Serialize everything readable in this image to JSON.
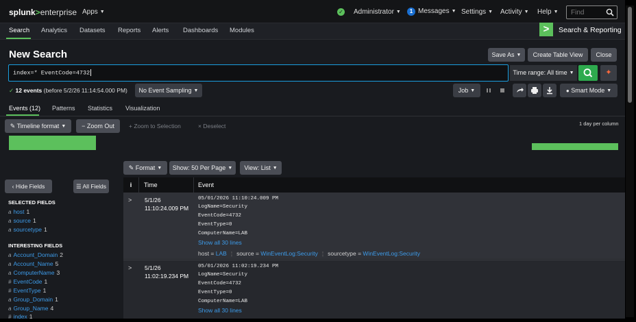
{
  "topbar": {
    "logo_brand": "splunk",
    "logo_chevron": ">",
    "logo_product": "enterprise",
    "apps": "Apps",
    "user": "Administrator",
    "messages_count": "1",
    "messages": "Messages",
    "settings": "Settings",
    "activity": "Activity",
    "help": "Help",
    "find_placeholder": "Find"
  },
  "appnav": {
    "items": [
      "Search",
      "Analytics",
      "Datasets",
      "Reports",
      "Alerts",
      "Dashboards",
      "Modules"
    ],
    "app_logo": ">",
    "app_name": "Search & Reporting"
  },
  "header": {
    "title": "New Search",
    "save_as": "Save As",
    "create_table_view": "Create Table View",
    "close": "Close"
  },
  "search": {
    "query": "index=* EventCode=4732",
    "time_range": "Time range: All time"
  },
  "status": {
    "check": "✓",
    "count": "12 events",
    "before": "(before 5/2/26 11:14:54.000 PM)",
    "sampling": "No Event Sampling",
    "job": "Job",
    "smart_mode": "Smart Mode"
  },
  "tabs": [
    "Events (12)",
    "Patterns",
    "Statistics",
    "Visualization"
  ],
  "timeline": {
    "format": "Timeline format",
    "zoom_out": "Zoom Out",
    "zoom_selection": "Zoom to Selection",
    "deselect": "Deselect",
    "per_column": "1 day per column"
  },
  "results_toolbar": {
    "format": "Format",
    "show": "Show: 50 Per Page",
    "view": "View: List"
  },
  "sidebar": {
    "hide_fields": "Hide Fields",
    "all_fields": "All Fields",
    "selected_heading": "SELECTED FIELDS",
    "selected": [
      {
        "type": "a",
        "name": "host",
        "count": "1"
      },
      {
        "type": "a",
        "name": "source",
        "count": "1"
      },
      {
        "type": "a",
        "name": "sourcetype",
        "count": "1"
      }
    ],
    "interesting_heading": "INTERESTING FIELDS",
    "interesting": [
      {
        "type": "a",
        "name": "Account_Domain",
        "count": "2"
      },
      {
        "type": "a",
        "name": "Account_Name",
        "count": "5"
      },
      {
        "type": "a",
        "name": "ComputerName",
        "count": "3"
      },
      {
        "type": "#",
        "name": "EventCode",
        "count": "1"
      },
      {
        "type": "#",
        "name": "EventType",
        "count": "1"
      },
      {
        "type": "a",
        "name": "Group_Domain",
        "count": "1"
      },
      {
        "type": "a",
        "name": "Group_Name",
        "count": "4"
      },
      {
        "type": "#",
        "name": "index",
        "count": "1"
      }
    ]
  },
  "table": {
    "col_info": "i",
    "col_time": "Time",
    "col_event": "Event",
    "events": [
      {
        "date": "5/1/26",
        "time": "11:10:24.009 PM",
        "lines": [
          "05/01/2026 11:10:24.009 PM",
          "LogName=Security",
          "EventCode=4732",
          "EventType=0",
          "ComputerName=LAB"
        ],
        "show_all": "Show all 30 lines",
        "host_label": "host =",
        "host": "LAB",
        "source_label": "source =",
        "source": "WinEventLog:Security",
        "sourcetype_label": "sourcetype =",
        "sourcetype": "WinEventLog:Security"
      },
      {
        "date": "5/1/26",
        "time": "11:02:19.234 PM",
        "lines": [
          "05/01/2026 11:02:19.234 PM",
          "LogName=Security",
          "EventCode=4732",
          "EventType=0",
          "ComputerName=LAB"
        ],
        "show_all": "Show all 30 lines"
      }
    ]
  },
  "colors": {
    "accent_green": "#5cc05c",
    "link_blue": "#3d9be9",
    "search_border": "#1a9fe0"
  }
}
